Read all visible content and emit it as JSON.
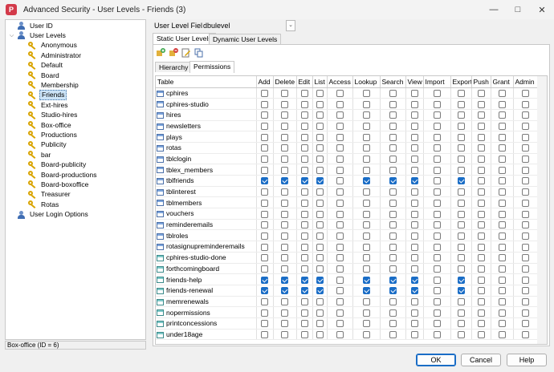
{
  "window": {
    "title": "Advanced Security - User Levels - Friends (3)",
    "app_icon": "P"
  },
  "tree": {
    "root_items": [
      {
        "label": "User ID",
        "icon": "user-icon"
      },
      {
        "label": "User Levels",
        "icon": "user-icon",
        "expanded": true
      }
    ],
    "levels": [
      "Anonymous",
      "Administrator",
      "Default",
      "Board",
      "Membership",
      "Friends",
      "Ext-hires",
      "Studio-hires",
      "Box-office",
      "Productions",
      "Publicity",
      "bar",
      "Board-publicity",
      "Board-productions",
      "Board-boxoffice",
      "Treasurer",
      "Rotas"
    ],
    "selected": "Friends",
    "footer_item": {
      "label": "User Login Options",
      "icon": "user-icon"
    }
  },
  "status": "Box-office (ID = 6)",
  "user_level_field": {
    "label": "User Level Field",
    "value": "dbulevel"
  },
  "tabs": [
    "Static User Levels",
    "Dynamic User Levels"
  ],
  "subtabs": [
    "Hierarchy",
    "Permissions"
  ],
  "grid": {
    "columns": [
      "Table",
      "Add",
      "Delete",
      "Edit",
      "List",
      "Access",
      "Lookup",
      "Search",
      "View",
      "Import",
      "Export",
      "Push",
      "Grant",
      "Admin"
    ],
    "rows": [
      {
        "name": "cphires",
        "type": "table",
        "checks": [
          0,
          0,
          0,
          0,
          0,
          0,
          0,
          0,
          0,
          0,
          0,
          0,
          0
        ]
      },
      {
        "name": "cphires-studio",
        "type": "table",
        "checks": [
          0,
          0,
          0,
          0,
          0,
          0,
          0,
          0,
          0,
          0,
          0,
          0,
          0
        ]
      },
      {
        "name": "hires",
        "type": "table",
        "checks": [
          0,
          0,
          0,
          0,
          0,
          0,
          0,
          0,
          0,
          0,
          0,
          0,
          0
        ]
      },
      {
        "name": "newsletters",
        "type": "table",
        "checks": [
          0,
          0,
          0,
          0,
          0,
          0,
          0,
          0,
          0,
          0,
          0,
          0,
          0
        ]
      },
      {
        "name": "plays",
        "type": "table",
        "checks": [
          0,
          0,
          0,
          0,
          0,
          0,
          0,
          0,
          0,
          0,
          0,
          0,
          0
        ]
      },
      {
        "name": "rotas",
        "type": "table",
        "checks": [
          0,
          0,
          0,
          0,
          0,
          0,
          0,
          0,
          0,
          0,
          0,
          0,
          0
        ]
      },
      {
        "name": "tblclogin",
        "type": "table",
        "checks": [
          0,
          0,
          0,
          0,
          0,
          0,
          0,
          0,
          0,
          0,
          0,
          0,
          0
        ]
      },
      {
        "name": "tblex_members",
        "type": "table",
        "checks": [
          0,
          0,
          0,
          0,
          0,
          0,
          0,
          0,
          0,
          0,
          0,
          0,
          0
        ]
      },
      {
        "name": "tblfriends",
        "type": "table",
        "checks": [
          1,
          1,
          1,
          1,
          0,
          1,
          1,
          1,
          0,
          1,
          0,
          0,
          0
        ]
      },
      {
        "name": "tblinterest",
        "type": "table",
        "checks": [
          0,
          0,
          0,
          0,
          0,
          0,
          0,
          0,
          0,
          0,
          0,
          0,
          0
        ]
      },
      {
        "name": "tblmembers",
        "type": "table",
        "checks": [
          0,
          0,
          0,
          0,
          0,
          0,
          0,
          0,
          0,
          0,
          0,
          0,
          0
        ]
      },
      {
        "name": "vouchers",
        "type": "table",
        "checks": [
          0,
          0,
          0,
          0,
          0,
          0,
          0,
          0,
          0,
          0,
          0,
          0,
          0
        ]
      },
      {
        "name": "reminderemails",
        "type": "table",
        "checks": [
          0,
          0,
          0,
          0,
          0,
          0,
          0,
          0,
          0,
          0,
          0,
          0,
          0
        ]
      },
      {
        "name": "tblroles",
        "type": "table",
        "checks": [
          0,
          0,
          0,
          0,
          0,
          0,
          0,
          0,
          0,
          0,
          0,
          0,
          0
        ]
      },
      {
        "name": "rotasignupreminderemails",
        "type": "table",
        "checks": [
          0,
          0,
          0,
          0,
          0,
          0,
          0,
          0,
          0,
          0,
          0,
          0,
          0
        ]
      },
      {
        "name": "cphires-studio-done",
        "type": "view",
        "checks": [
          0,
          0,
          0,
          0,
          0,
          0,
          0,
          0,
          0,
          0,
          0,
          0,
          0
        ]
      },
      {
        "name": "forthcomingboard",
        "type": "view",
        "checks": [
          0,
          0,
          0,
          0,
          0,
          0,
          0,
          0,
          0,
          0,
          0,
          0,
          0
        ]
      },
      {
        "name": "friends-help",
        "type": "view",
        "checks": [
          1,
          1,
          1,
          1,
          0,
          1,
          1,
          1,
          0,
          1,
          0,
          0,
          0
        ]
      },
      {
        "name": "friends-renewal",
        "type": "view",
        "checks": [
          1,
          1,
          1,
          1,
          0,
          1,
          1,
          1,
          0,
          1,
          0,
          0,
          0
        ]
      },
      {
        "name": "memrenewals",
        "type": "view",
        "checks": [
          0,
          0,
          0,
          0,
          0,
          0,
          0,
          0,
          0,
          0,
          0,
          0,
          0
        ]
      },
      {
        "name": "nopermissions",
        "type": "view",
        "checks": [
          0,
          0,
          0,
          0,
          0,
          0,
          0,
          0,
          0,
          0,
          0,
          0,
          0
        ]
      },
      {
        "name": "printconcessions",
        "type": "view",
        "checks": [
          0,
          0,
          0,
          0,
          0,
          0,
          0,
          0,
          0,
          0,
          0,
          0,
          0
        ]
      },
      {
        "name": "under18age",
        "type": "view",
        "checks": [
          0,
          0,
          0,
          0,
          0,
          0,
          0,
          0,
          0,
          0,
          0,
          0,
          0
        ]
      }
    ]
  },
  "buttons": {
    "ok": "OK",
    "cancel": "Cancel",
    "help": "Help"
  },
  "colors": {
    "accent": "#1a6dc6",
    "selection": "#cce4f7"
  }
}
